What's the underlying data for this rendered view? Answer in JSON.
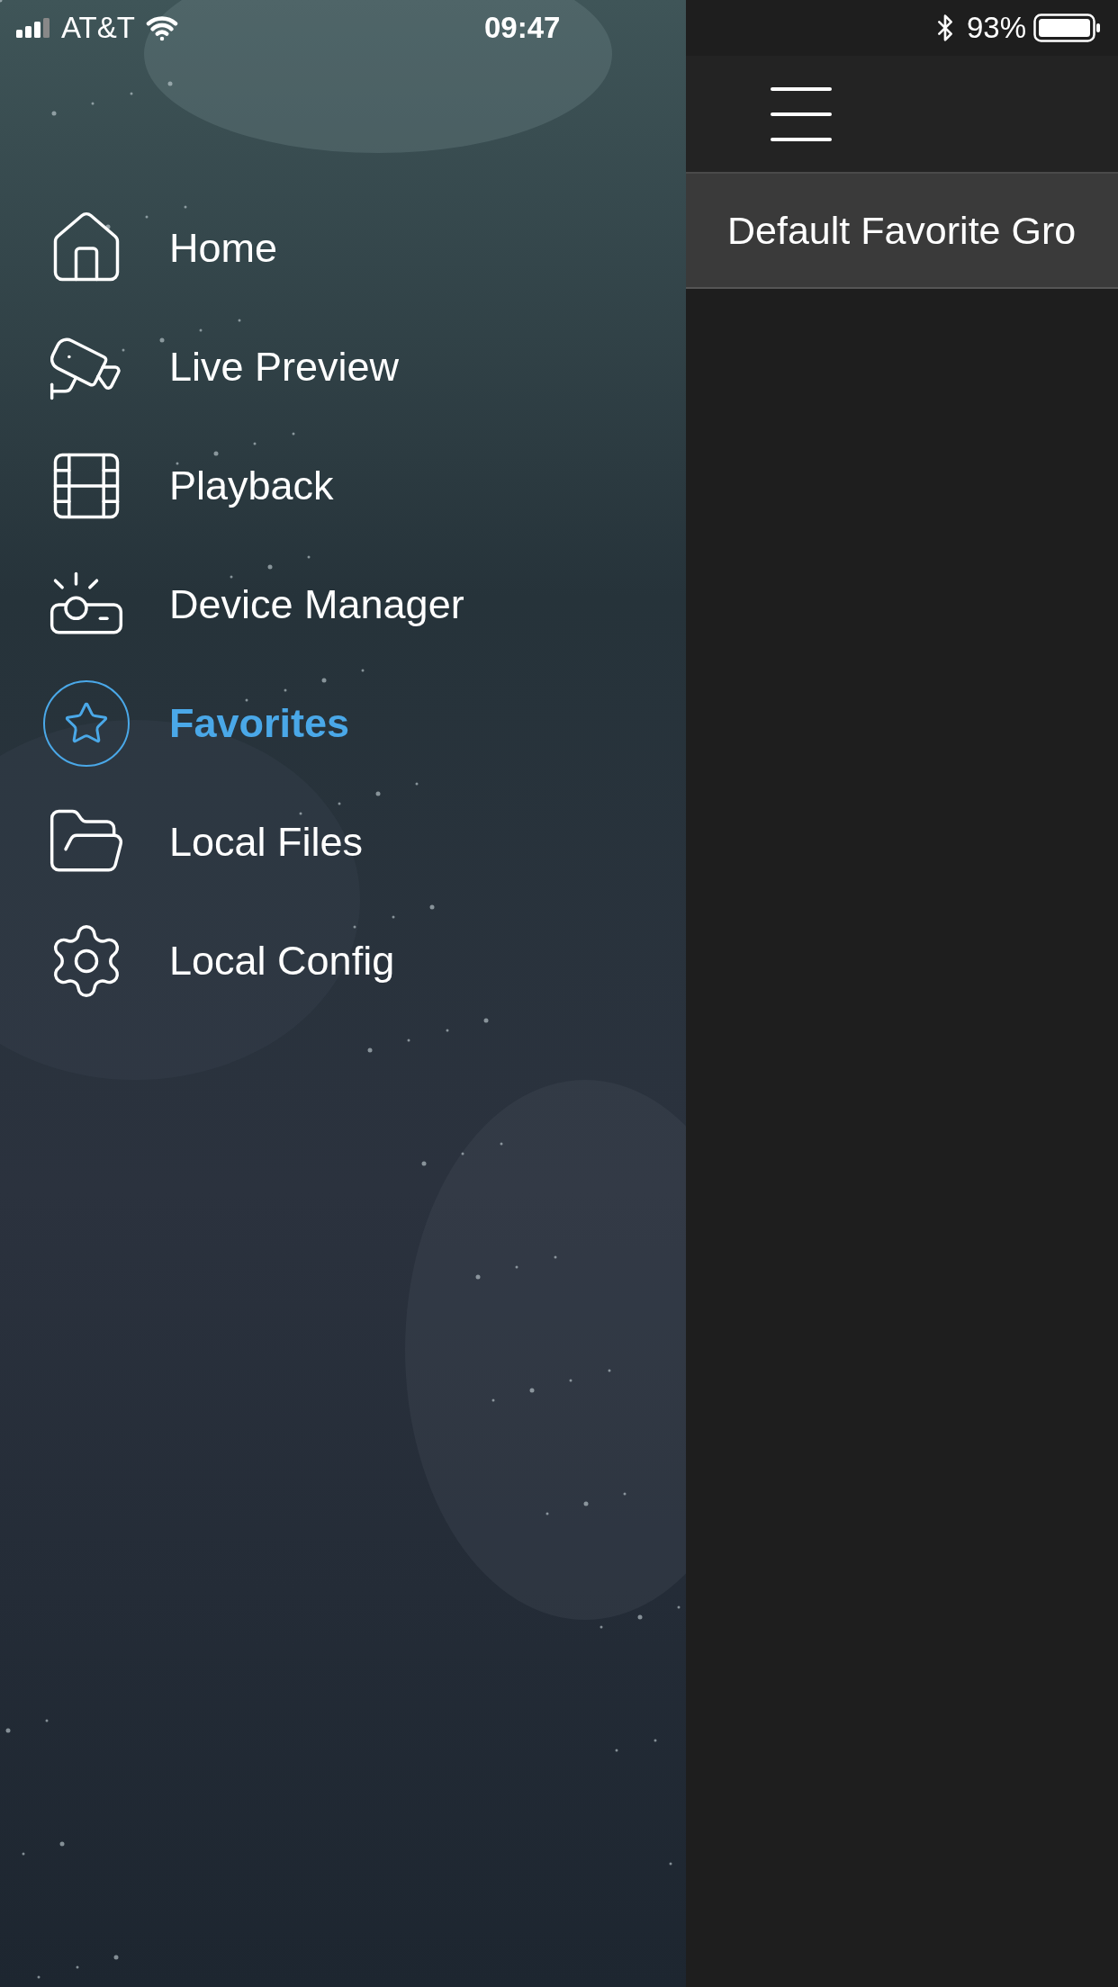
{
  "status_bar": {
    "carrier": "AT&T",
    "time": "09:47",
    "battery": "93%"
  },
  "sidebar": {
    "items": [
      {
        "kind": "home",
        "label": "Home",
        "selected": false
      },
      {
        "kind": "camera",
        "label": "Live Preview",
        "selected": false
      },
      {
        "kind": "film",
        "label": "Playback",
        "selected": false
      },
      {
        "kind": "device",
        "label": "Device Manager",
        "selected": false
      },
      {
        "kind": "star",
        "label": "Favorites",
        "selected": true
      },
      {
        "kind": "folder",
        "label": "Local Files",
        "selected": false
      },
      {
        "kind": "gear",
        "label": "Local Config",
        "selected": false
      }
    ]
  },
  "main": {
    "groups": [
      {
        "label": "Default Favorite Gro"
      }
    ]
  }
}
